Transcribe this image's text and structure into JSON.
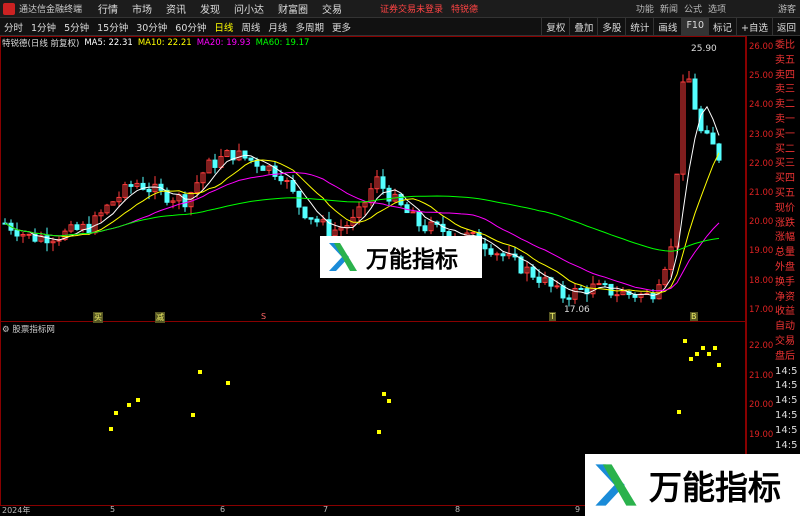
{
  "titlebar": {
    "app_title": "通达信金融终端",
    "menu": [
      "行情",
      "市场",
      "资讯",
      "发现",
      "问小达",
      "财富圈",
      "交易"
    ],
    "login_status": "证券交易未登录",
    "login_link": "特锐德",
    "window": [
      "功能",
      "新闻",
      "公式",
      "选项",
      "游客"
    ]
  },
  "toolbar": {
    "periods": [
      "分时",
      "1分钟",
      "5分钟",
      "15分钟",
      "30分钟",
      "60分钟",
      "日线",
      "周线",
      "月线",
      "多周期",
      "更多"
    ],
    "active_period": "日线",
    "tools": [
      "复权",
      "叠加",
      "多股",
      "统计",
      "画线",
      "F10",
      "标记",
      "+自选",
      "返回"
    ]
  },
  "legend": {
    "stock": "特锐德(日线 前复权)",
    "ma5": "MA5: 22.31",
    "ma10": "MA10: 22.21",
    "ma20": "MA20: 19.93",
    "ma60": "MA60: 19.17"
  },
  "indicator": {
    "name": "股票指标网"
  },
  "right_axis": {
    "main": [
      "26.00",
      "25.00",
      "24.00",
      "23.00",
      "22.00",
      "21.00",
      "20.00",
      "19.00",
      "18.00",
      "17.00"
    ],
    "indicator": [
      "22.00",
      "21.00",
      "20.00",
      "19.00"
    ]
  },
  "quote_panel": [
    "委比",
    "卖五",
    "卖四",
    "卖三",
    "卖二",
    "卖一",
    "买一",
    "买二",
    "买三",
    "买四",
    "买五",
    "现价",
    "涨跌",
    "涨幅",
    "总量",
    "外盘",
    "换手",
    "净资",
    "收益",
    "自动",
    "交易",
    "盘后",
    "14:5",
    "14:5",
    "14:5",
    "14:5",
    "14:5",
    "14:5",
    "14:5",
    "14:5"
  ],
  "price_labels": {
    "high": "25.90",
    "low": "17.06"
  },
  "dates": [
    "2024年",
    "5",
    "6",
    "7",
    "8",
    "9"
  ],
  "markers": [
    "买",
    "减",
    "S",
    "T",
    "B"
  ],
  "watermark": {
    "text": "万能指标"
  },
  "colors": {
    "up": "#ff3c3c",
    "down": "#54ffff",
    "ma5": "#ffffff",
    "ma10": "#ffff00",
    "ma20": "#ff00ff",
    "ma60": "#00ff00",
    "axis": "#d22"
  }
}
